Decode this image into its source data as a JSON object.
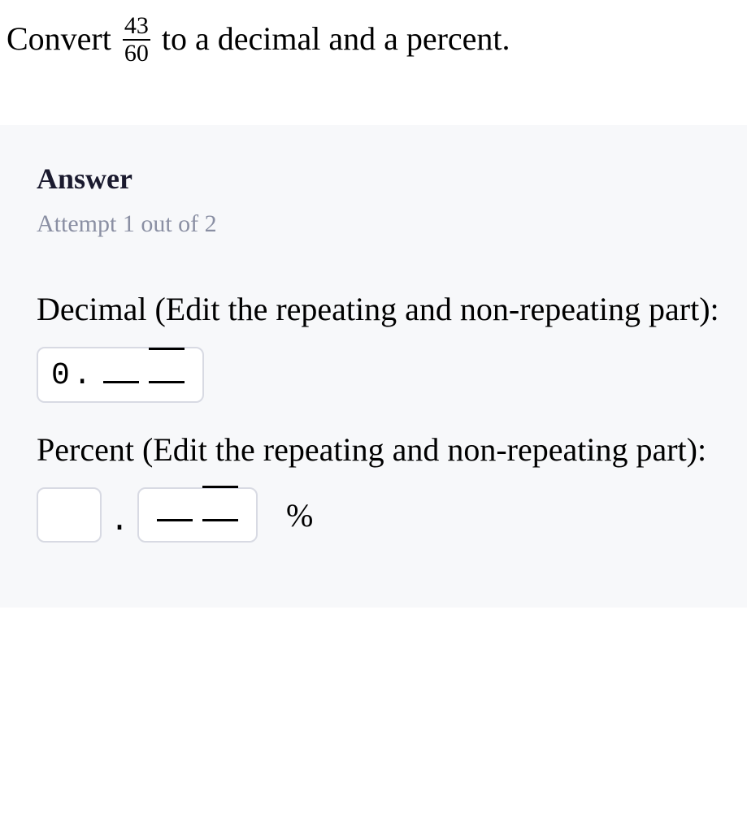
{
  "question": {
    "prefix": "Convert",
    "fraction": {
      "numerator": "43",
      "denominator": "60"
    },
    "suffix": "to a decimal and a percent."
  },
  "answer": {
    "heading": "Answer",
    "attempt": "Attempt 1 out of 2",
    "decimal": {
      "label": "Decimal (Edit the repeating and non-repeating part):",
      "prefill": "0."
    },
    "percent": {
      "label": "Percent (Edit the repeating and non-repeating part):",
      "suffix": "%"
    }
  }
}
